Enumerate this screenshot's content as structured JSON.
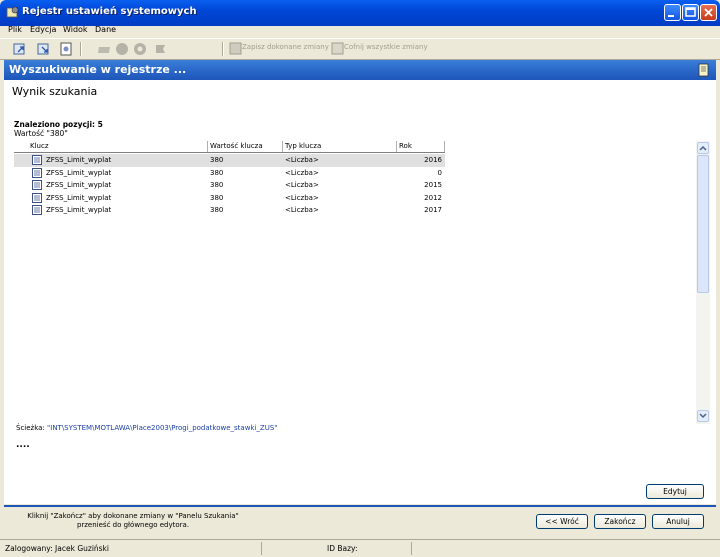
{
  "window": {
    "title": "Rejestr ustawień systemowych"
  },
  "menu": [
    "Plik",
    "Edycja",
    "Widok",
    "Dane"
  ],
  "toolbar": {
    "save_label": "Zapisz dokonane zmiany",
    "undo_label": "Cofnij wszystkie zmiany"
  },
  "header": {
    "title": "Wyszukiwanie w rejestrze ..."
  },
  "main": {
    "heading": "Wynik szukania",
    "found": "Znaleziono pozycji: 5",
    "value": "Wartość \"380\"",
    "columns": [
      "Klucz",
      "Wartość klucza",
      "Typ klucza",
      "Rok"
    ],
    "rows": [
      {
        "key": "ZFSS_Limit_wyplat",
        "value": "380",
        "type": "<Liczba>",
        "year": "2016"
      },
      {
        "key": "ZFSS_Limit_wyplat",
        "value": "380",
        "type": "<Liczba>",
        "year": "0"
      },
      {
        "key": "ZFSS_Limit_wyplat",
        "value": "380",
        "type": "<Liczba>",
        "year": "2015"
      },
      {
        "key": "ZFSS_Limit_wyplat",
        "value": "380",
        "type": "<Liczba>",
        "year": "2012"
      },
      {
        "key": "ZFSS_Limit_wyplat",
        "value": "380",
        "type": "<Liczba>",
        "year": "2017"
      }
    ],
    "path_label": "Ścieżka:",
    "path_value": "\"INT\\SYSTEM\\MOTLAWA\\Place2003\\Progi_podatkowe_stawki_ZUS\"",
    "dots": "....",
    "edit_button": "Edytuj"
  },
  "footer": {
    "hint_line1": "Kliknij \"Zakończ\" aby dokonane zmiany w \"Panelu Szukania\"",
    "hint_line2": "przenieść do głównego edytora.",
    "back_button": "<< Wróć",
    "finish_button": "Zakończ",
    "cancel_button": "Anuluj"
  },
  "status": {
    "user": "Zalogowany: Jacek Guziński",
    "db": "ID Bazy:"
  }
}
